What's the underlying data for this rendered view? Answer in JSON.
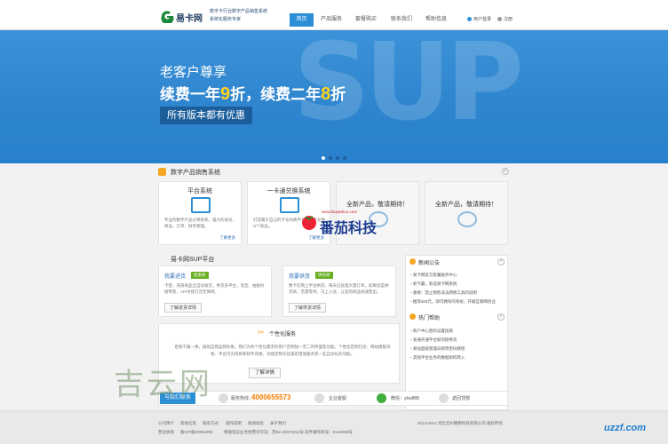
{
  "header": {
    "logo_text": "易卡网",
    "slogan": "数字卡行业数字产品销售系统 系统化服务专家",
    "nav": [
      "首页",
      "产品服务",
      "套餐购买",
      "联系我们",
      "帮助信息"
    ],
    "login": "用户登录",
    "register": "注册"
  },
  "banner": {
    "line1": "老客户尊享",
    "line2_a": "续费一年",
    "line2_b": "9",
    "line2_c": "折，续费二年",
    "line2_d": "8",
    "line2_e": "折",
    "line3": "所有版本都有优惠",
    "bg_text": "SUP",
    "slides": 4,
    "active_slide": 0
  },
  "section1": {
    "title": "数字产品销售系统",
    "cards": [
      {
        "title": "平台系统",
        "desc": "专业的数字产品分销系统，强大的会员、商品、订单、财务管理。",
        "more": "了解更多"
      },
      {
        "title": "一卡通兑换系统",
        "desc": "打造属于自己的卡号兑换平台，一卡兑换N个商品。",
        "more": "了解更多"
      },
      {
        "title": "全新产品，敬请期待！"
      },
      {
        "title": "全新产品，敬请期待！"
      }
    ]
  },
  "sup": {
    "title": "易卡网SUP平台",
    "boxes": [
      {
        "title": "我要进货",
        "tag": "批发商",
        "desc": "卡密、充值商品全自动发货，供货多平台，淘宝、拍拍对接零售，API对接订货无障碍。",
        "button": "了解进货详情"
      },
      {
        "title": "我要供货",
        "tag": "供货商",
        "desc": "数卡在网上平台供货，每天已处理大量订单，如果您是供货商，无需等待，马上入驻，让您的商品快速售出。",
        "button": "了解供货详情"
      }
    ]
  },
  "personal": {
    "title": "个性化服务",
    "desc": "拒绝千篇一律，展现自我品牌形象。我们为有个性化需求的用户定制独一无二的界面及功能，个性化定制包括：网站模板风格、平台内页风格和软件风格，功能定制包括满足增值服务等一些自动化的功能。",
    "button": "了解详情"
  },
  "news": {
    "title": "新闻公告",
    "items": [
      "易卡网官方套餐服务中心",
      "新卡霸，新选易卡网系统",
      "重要：禁止销售非法网络工具的说明",
      "推荐500元，即可拥有的系统，开展互联网创业"
    ],
    "help_title": "热门帮助",
    "help_items": [
      "商户中心密码设置指南",
      "会通开通平台如何接供货",
      "易站超级管理员修改密码教程",
      "其他平台业务的数据如何转入"
    ]
  },
  "contact": {
    "tab": "与我们联系",
    "phone_label": "服务热线：",
    "phone": "4000655573",
    "qq_label": "企业客服",
    "wechat_label": "微信：ykw888",
    "top_label": "返回顶部"
  },
  "footer": {
    "links": [
      "公司简介",
      "帮助信息",
      "联系方式",
      "操作说明",
      "新闻动态",
      "关于我们"
    ],
    "license": "营业执照",
    "icp": "备ICP备00051890",
    "cert": "增值电信业务经营许可证：苏B2-20070213号 软件著作权号：0142069号",
    "copyright": "2013-2014 河北沧州网络科技有限公司 版权所有"
  },
  "watermarks": {
    "left": "吉云网",
    "center_url": "www.fanqiekoo.com",
    "center_brand": "番茄科技",
    "right": "uzzf.com"
  },
  "colors": {
    "accent": "#2b8fd6",
    "banner": "#3189d2",
    "highlight": "#ffd21f",
    "phone": "#f57c00",
    "tag": "#6ab023"
  }
}
